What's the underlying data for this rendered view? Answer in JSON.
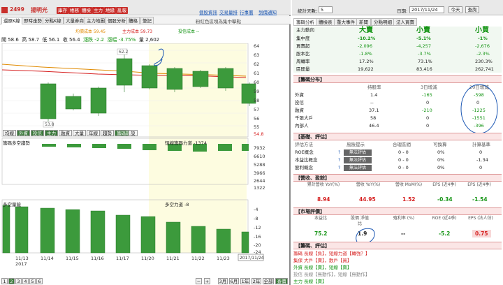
{
  "header": {
    "code": "2499",
    "name": "揚明光",
    "buttons": [
      "庫存",
      "帳務",
      "體檢",
      "主力",
      "地緣",
      "亂報"
    ],
    "links": [
      "個股資訊",
      "交易量排",
      "行事曆",
      "到價通知"
    ]
  },
  "left_tabs": [
    "還原K線",
    "即時走勢",
    "分點K線",
    "大量券商",
    "主力地圖",
    "個股分析",
    "體格",
    "筆記"
  ],
  "cost_row": {
    "avg": "均價成本 59.45",
    "main": "主力成本 59.73",
    "invest": "投信成本 --",
    "note": "粉紅色區塊為集中擊點"
  },
  "ohlc": {
    "open": "開 58.6",
    "high": "高 58.7",
    "low": "低 56.1",
    "close": "收 56.4",
    "change": "漲跌 -2.2",
    "pct": "漲幅 -3.75%",
    "vol": "量 2,602"
  },
  "price_axis": [
    "64",
    "63",
    "62",
    "61",
    "60",
    "59",
    "58",
    "57",
    "56",
    "55",
    "54.8",
    "54"
  ],
  "price_labels": {
    "high": "62.2",
    "low": "53.8"
  },
  "tools": [
    "均線",
    "外資",
    "投信",
    "主力",
    "融資",
    "大量",
    "年線",
    "趨勢",
    "籌碼戰",
    "設"
  ],
  "ind1": {
    "label": "籌碼多空趨勢",
    "legend": "短線籌碼力道 -1374",
    "axis": [
      "7932",
      "6610",
      "5288",
      "3966",
      "2644",
      "1322"
    ]
  },
  "ind2": {
    "label": "多空量能",
    "legend": "多空力道 -8",
    "axis": [
      "-4",
      "-8",
      "-12",
      "-16",
      "-20",
      "-24"
    ]
  },
  "dates": [
    "11/13",
    "11/14",
    "11/15",
    "11/16",
    "11/17",
    "11/20",
    "11/21",
    "11/22",
    "11/23",
    "2017/11/24"
  ],
  "year": "2017",
  "nav": [
    "1",
    "2",
    "3",
    "4",
    "5",
    "6"
  ],
  "ranges": [
    "3月",
    "6月",
    "1年",
    "2年",
    "全部",
    "查價"
  ],
  "right_header": {
    "days_label": "統計天數：",
    "days": "5",
    "date_label": "日期:",
    "date": "2017/11/24",
    "prev": "今天",
    "next": "查詢"
  },
  "right_tabs": [
    "籌碼分析",
    "體檢表",
    "重大事件",
    "新聞",
    "分點明細",
    "法人買賣"
  ],
  "summary": {
    "head": [
      "主力動向",
      "大賣",
      "小賣",
      "小買"
    ],
    "rows": [
      [
        "集中度",
        "-10.2%",
        "-5.1%",
        "-1%"
      ],
      [
        "買賣超",
        "-2,096",
        "-4,257",
        "-2,676"
      ],
      [
        "股本比",
        "-1.8%",
        "-3.7%",
        "-2.3%"
      ],
      [
        "周轉率",
        "17.2%",
        "73.1%",
        "230.3%"
      ],
      [
        "區間量",
        "19,622",
        "83,416",
        "262,741"
      ]
    ]
  },
  "chip": {
    "title": "【籌碼分布】",
    "head": [
      "",
      "持股率",
      "3日增減",
      "20日增減"
    ],
    "rows": [
      [
        "外資",
        "1.4",
        "-165",
        "-598"
      ],
      [
        "投信",
        "--",
        "0",
        "0"
      ],
      [
        "融資",
        "37.1",
        "-210",
        "-1225"
      ],
      [
        "千張大戶",
        "58",
        "0",
        "-1551"
      ],
      [
        "內部人",
        "46.4",
        "0",
        "-396"
      ]
    ]
  },
  "value": {
    "title": "【基礎、評估】",
    "head": [
      "評估方法",
      "風險提示",
      "合理區間",
      "可換算",
      "計算基準"
    ],
    "rows": [
      [
        "ROE概念",
        "無法評估",
        "0 - 0",
        "0%",
        "0"
      ],
      [
        "本益比概念",
        "無法評估",
        "0 - 0",
        "0%",
        "-1.34"
      ],
      [
        "股利概念",
        "無法評估",
        "0 - 0",
        "0%",
        "0"
      ]
    ]
  },
  "revenue": {
    "title": "【營收、盈餘】",
    "head": [
      "累計營收 YoY(%)",
      "營收 YoY(%)",
      "營收 MoM(%)",
      "EPS (近4季)",
      "EPS (近4季)"
    ],
    "vals": [
      "8.94",
      "44.95",
      "1.52",
      "-0.34",
      "-1.54"
    ]
  },
  "market": {
    "title": "【市場評價】",
    "head": [
      "本益比",
      "股價 淨值比",
      "殖利率 (%)",
      "ROE (近4季)",
      "EPS (法人估)"
    ],
    "vals": [
      "75.2",
      "1.9",
      "--",
      "-5.2",
      "0.75"
    ]
  },
  "chipeval": {
    "title": "【籌碼、評估】",
    "lines": [
      "籌碼 長線【負】，短線力道【轉強？】",
      "集保 大戶【賣】，散戶【買】",
      "外資 長線【賣】，短線【賣】",
      "投信 長線【無動作】，短線【無動作】",
      "主力 長線【賣】"
    ]
  }
}
